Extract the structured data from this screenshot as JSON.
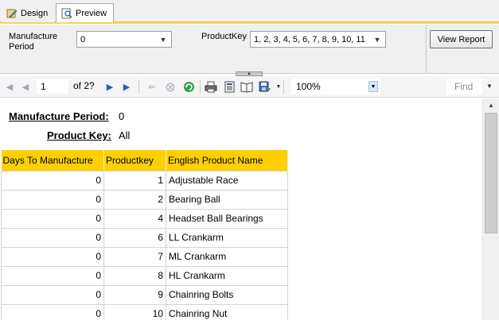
{
  "tabs": {
    "design_label": "Design",
    "preview_label": "Preview"
  },
  "parameters": {
    "manufacture_period_label": "Manufacture Period",
    "manufacture_period_value": "0",
    "product_key_label": "ProductKey",
    "product_key_value": "1, 2, 3, 4, 5, 6, 7, 8, 9, 10, 11",
    "view_report_label": "View Report"
  },
  "toolbar": {
    "page_number": "1",
    "page_of": "of  2?",
    "zoom": "100%",
    "find_placeholder": "Find"
  },
  "report": {
    "manufacture_period_label": "Manufacture Period:",
    "manufacture_period_value": "0",
    "product_key_label": "Product Key:",
    "product_key_value": "All",
    "columns": [
      "Days To Manufacture",
      "Productkey",
      "English Product Name"
    ],
    "rows": [
      [
        "0",
        "1",
        "Adjustable Race"
      ],
      [
        "0",
        "2",
        "Bearing Ball"
      ],
      [
        "0",
        "4",
        "Headset Ball Bearings"
      ],
      [
        "0",
        "6",
        "LL Crankarm"
      ],
      [
        "0",
        "7",
        "ML Crankarm"
      ],
      [
        "0",
        "8",
        "HL Crankarm"
      ],
      [
        "0",
        "9",
        "Chainring Bolts"
      ],
      [
        "0",
        "10",
        "Chainring Nut"
      ]
    ]
  },
  "colors": {
    "header_fill": "#ffd000",
    "tab_accent": "#f0c23c",
    "nav_active": "#1e60c8"
  }
}
